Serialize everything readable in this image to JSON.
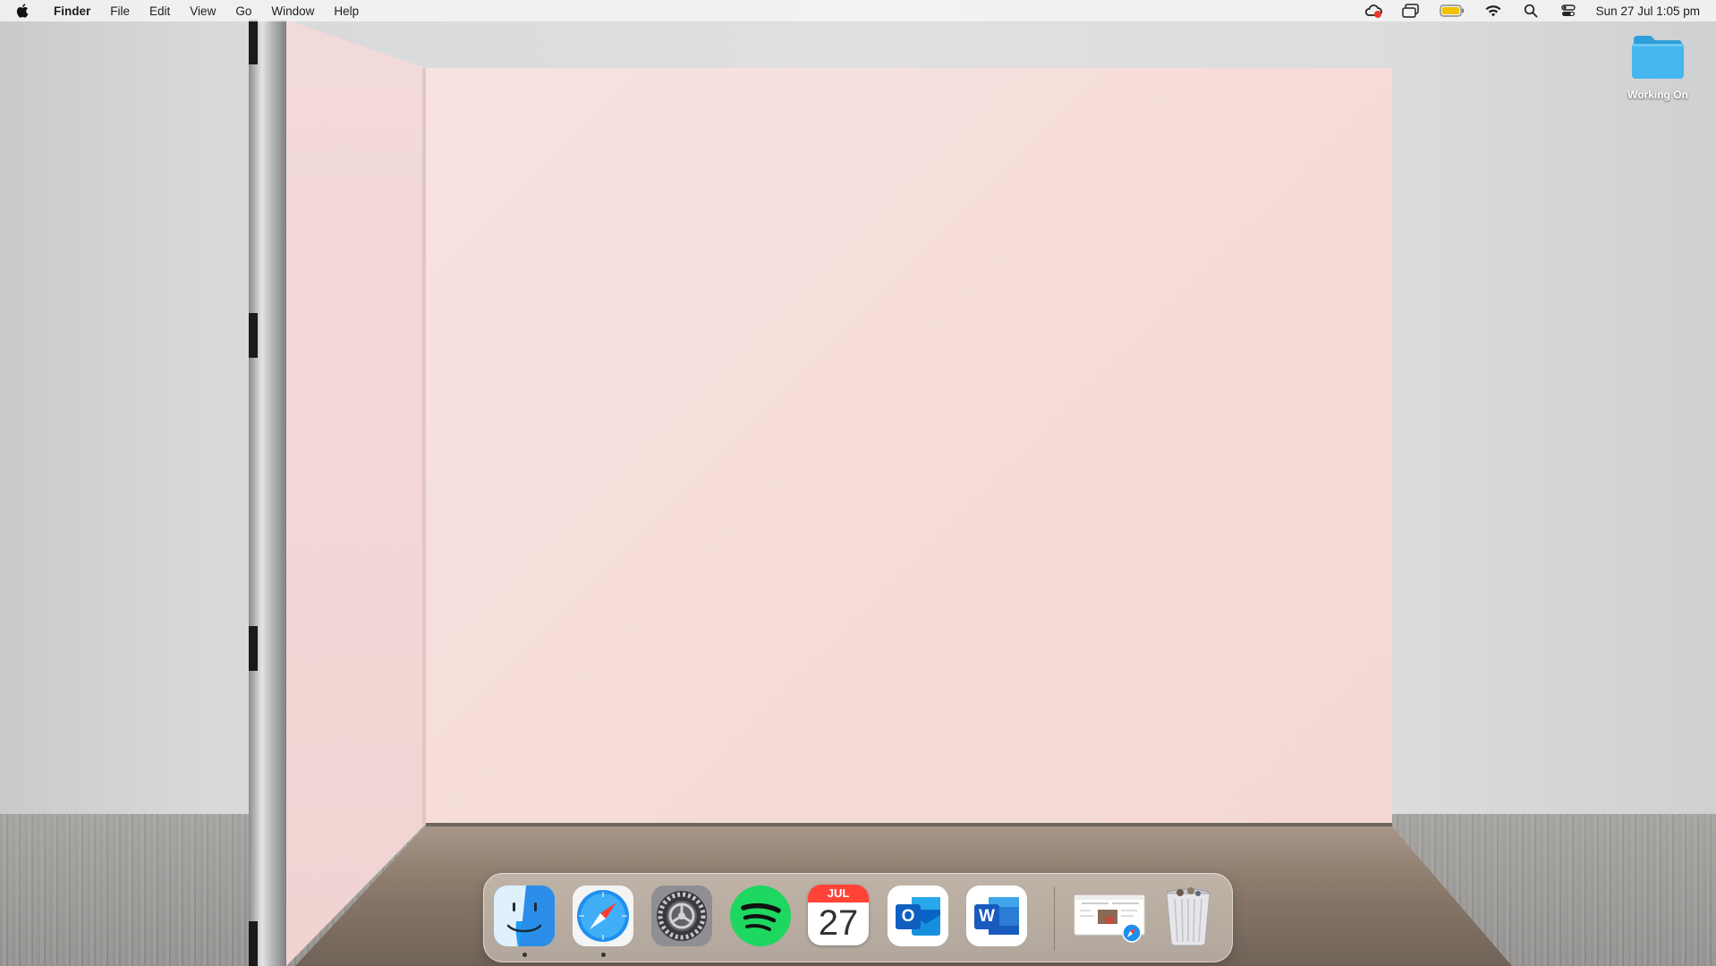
{
  "menubar": {
    "app_name": "Finder",
    "menus": [
      "File",
      "Edit",
      "View",
      "Go",
      "Window",
      "Help"
    ],
    "clock": "Sun 27 Jul  1:05 pm",
    "status_icons": [
      "creative-cloud-icon",
      "screen-mirroring-icon",
      "battery-icon",
      "wifi-icon",
      "spotlight-search-icon",
      "control-center-icon"
    ]
  },
  "desktop": {
    "folder_label": "Working On",
    "folder_color": "#3fb0e8"
  },
  "dock": {
    "apps": [
      {
        "name": "finder-icon",
        "running": true
      },
      {
        "name": "safari-icon",
        "running": true
      },
      {
        "name": "system-settings-icon",
        "running": false
      },
      {
        "name": "spotify-icon",
        "running": false
      },
      {
        "name": "calendar-icon",
        "running": false
      },
      {
        "name": "outlook-icon",
        "running": false
      },
      {
        "name": "word-icon",
        "running": false
      }
    ],
    "calendar_month": "JUL",
    "calendar_day": "27",
    "outlook_letter": "O",
    "word_letter": "W",
    "minimized_window": "safari-minimized-window",
    "trash": "trash-icon"
  }
}
